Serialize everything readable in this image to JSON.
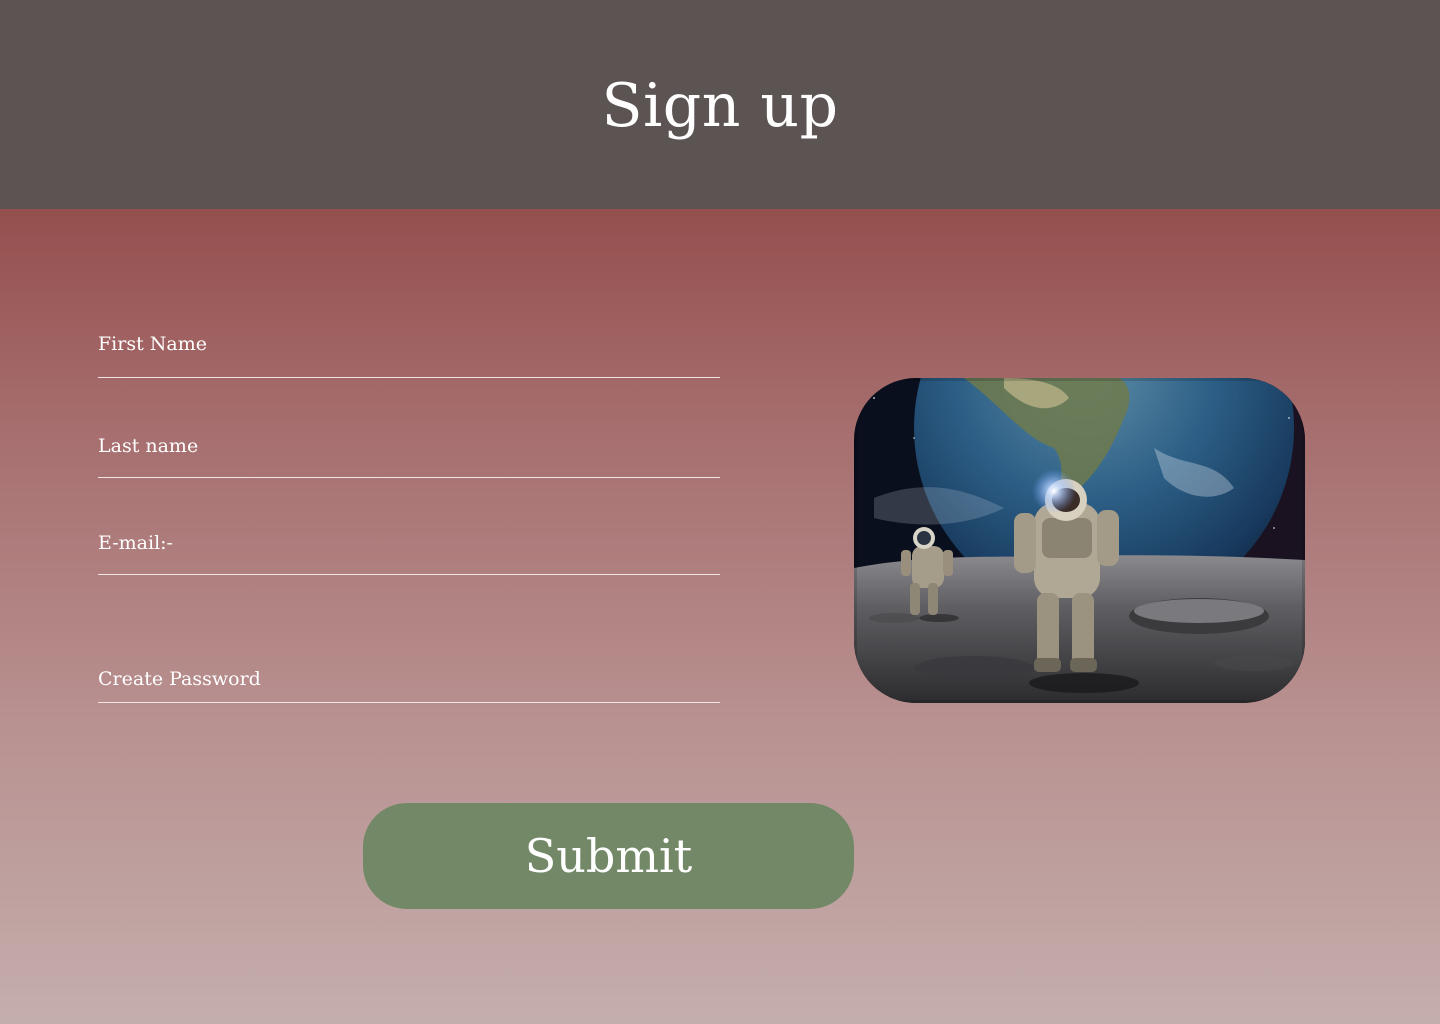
{
  "header": {
    "title": "Sign up"
  },
  "form": {
    "fields": [
      {
        "label": "First Name",
        "value": ""
      },
      {
        "label": "Last name",
        "value": ""
      },
      {
        "label": "E-mail:-",
        "value": ""
      },
      {
        "label": "Create Password",
        "value": ""
      }
    ],
    "submit_label": "Submit"
  },
  "image": {
    "subject": "astronauts-on-moon-with-earth"
  },
  "colors": {
    "header_bg": "#5c5453",
    "body_gradient_top": "#944f4e",
    "body_gradient_bottom": "#c4aeac",
    "submit_bg": "#728867",
    "text": "#ffffff"
  }
}
